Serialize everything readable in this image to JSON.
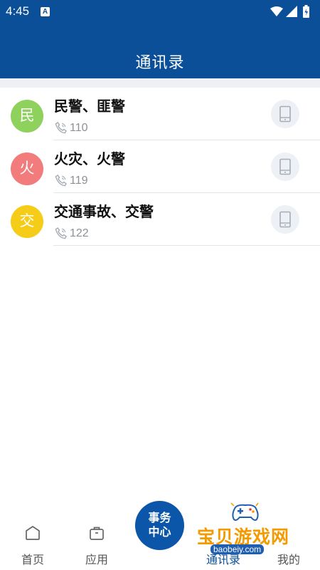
{
  "status_bar": {
    "time": "4:45",
    "app_icon_letter": "A"
  },
  "header": {
    "title": "通讯录"
  },
  "contacts": [
    {
      "avatar": "民",
      "avatar_color": "#8ed15d",
      "name": "民警、匪警",
      "phone": "110"
    },
    {
      "avatar": "火",
      "avatar_color": "#f27b7b",
      "name": "火灾、火警",
      "phone": "119"
    },
    {
      "avatar": "交",
      "avatar_color": "#f5cc18",
      "name": "交通事故、交警",
      "phone": "122"
    }
  ],
  "tab_bar": {
    "home": "首页",
    "apps": "应用",
    "center_line1": "事务",
    "center_line2": "中心",
    "contacts": "通讯录",
    "mine": "我的"
  },
  "watermark": {
    "text": "宝贝游戏网",
    "url": "baobeiy.com"
  },
  "colors": {
    "primary": "#0a4f98",
    "divider": "#e3e5e8",
    "watermark": "#f39a00"
  }
}
